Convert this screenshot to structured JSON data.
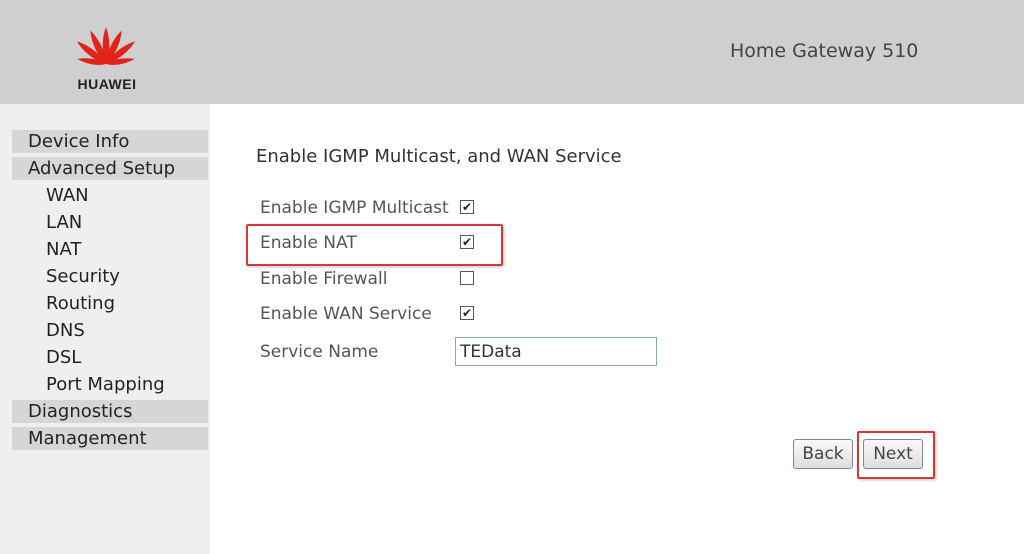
{
  "header": {
    "brand": "HUAWEI",
    "product_title": "Home Gateway 510",
    "logo_icon": "huawei-petal-logo"
  },
  "sidebar": {
    "items": [
      {
        "label": "Device Info",
        "level": "top"
      },
      {
        "label": "Advanced Setup",
        "level": "top"
      },
      {
        "label": "WAN",
        "level": "sub"
      },
      {
        "label": "LAN",
        "level": "sub"
      },
      {
        "label": "NAT",
        "level": "sub"
      },
      {
        "label": "Security",
        "level": "sub"
      },
      {
        "label": "Routing",
        "level": "sub"
      },
      {
        "label": "DNS",
        "level": "sub"
      },
      {
        "label": "DSL",
        "level": "sub"
      },
      {
        "label": "Port Mapping",
        "level": "sub"
      },
      {
        "label": "Diagnostics",
        "level": "top"
      },
      {
        "label": "Management",
        "level": "top"
      }
    ]
  },
  "main": {
    "title": "Enable IGMP Multicast, and WAN Service",
    "options": [
      {
        "label": "Enable IGMP Multicast",
        "checked": true
      },
      {
        "label": "Enable NAT",
        "checked": true
      },
      {
        "label": "Enable Firewall",
        "checked": false
      },
      {
        "label": "Enable WAN Service",
        "checked": true
      }
    ],
    "service_name": {
      "label": "Service Name",
      "value": "TEData"
    },
    "buttons": {
      "back": "Back",
      "next": "Next"
    }
  },
  "colors": {
    "header_bg": "#cfcfcf",
    "sidebar_bg": "#efefef",
    "menu_top_bg": "#d6d6d6",
    "highlight": "#d23a3a",
    "brand_red": "#e2231a"
  }
}
